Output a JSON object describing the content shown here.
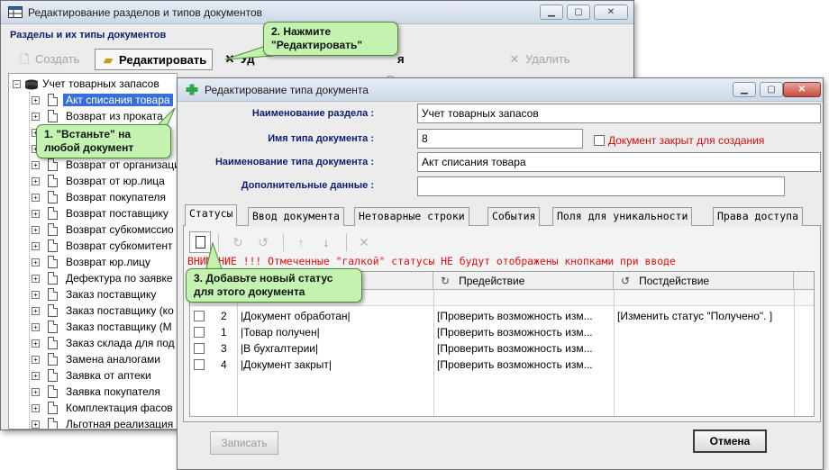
{
  "main_window": {
    "title": "Редактирование разделов и типов документов",
    "section_label": "Разделы и их типы документов",
    "toolbar": {
      "create": "Создать",
      "edit": "Редактировать",
      "delete_partial": "Уд",
      "partial_right": "я",
      "edit2": "Редактировать",
      "delete2": "Удалить"
    },
    "tree": {
      "root": "Учет товарных запасов",
      "items": [
        "Акт списания товара",
        "Возврат из проката",
        "",
        "",
        "Возврат от организаци",
        "Возврат от юр.лица",
        "Возврат покупателя",
        "Возврат поставщику",
        "Возврат субкомиссио",
        "Возврат субкомитент",
        "Возврат юр.лицу",
        "Дефектура по заявке",
        "Заказ поставщику",
        "Заказ поставщику (ко",
        "Заказ поставщику (М",
        "Заказ склада для под",
        "Замена аналогами",
        "Заявка от аптеки",
        "Заявка покупателя",
        "Комплектация фасов",
        "Льготная реализация"
      ]
    }
  },
  "dialog": {
    "title": "Редактирование типа документа",
    "fields": {
      "section_name_label": "Наименование раздела :",
      "section_name_value": "Учет товарных запасов",
      "type_name_label": "Имя типа документа :",
      "type_name_value": "8",
      "closed_label": "Документ закрыт для создания",
      "doc_type_name_label": "Наименование типа документа :",
      "doc_type_name_value": "Акт списания товара",
      "extra_label": "Дополнительные данные :",
      "extra_value": ""
    },
    "tabs": [
      "Статусы",
      "Ввод документа",
      "Нетоварные строки",
      "События",
      "Поля для уникальности",
      "Права доступа"
    ],
    "warning": "ВНИМАНИЕ !!! Отмеченные \"галкой\" статусы НЕ будут отображены кнопками при вводе",
    "grid": {
      "headers": [
        "Предействие",
        "Постдействие"
      ],
      "rows": [
        {
          "num": "2",
          "name": "|Документ обработан|",
          "pre": "[Проверить возможность изм...",
          "post": "[Изменить статус \"Получено\". ]"
        },
        {
          "num": "1",
          "name": "|Товар получен|",
          "pre": "[Проверить возможность изм...",
          "post": ""
        },
        {
          "num": "3",
          "name": "|В бухгалтерии|",
          "pre": "[Проверить возможность изм...",
          "post": ""
        },
        {
          "num": "4",
          "name": "|Документ закрыт|",
          "pre": "[Проверить возможность изм...",
          "post": ""
        }
      ]
    },
    "buttons": {
      "save": "Записать",
      "cancel": "Отмена"
    }
  },
  "callouts": {
    "step1": "1. \"Встаньте\" на любой документ",
    "step2": "2. Нажмите \"Редактировать\"",
    "step3": "3. Добавьте новый статус для этого документа"
  },
  "colors": {
    "callout_bg": "#c4f2b0",
    "selection": "#3a6fd8",
    "warning_red": "#e01010",
    "label_blue": "#0a1e6e"
  }
}
